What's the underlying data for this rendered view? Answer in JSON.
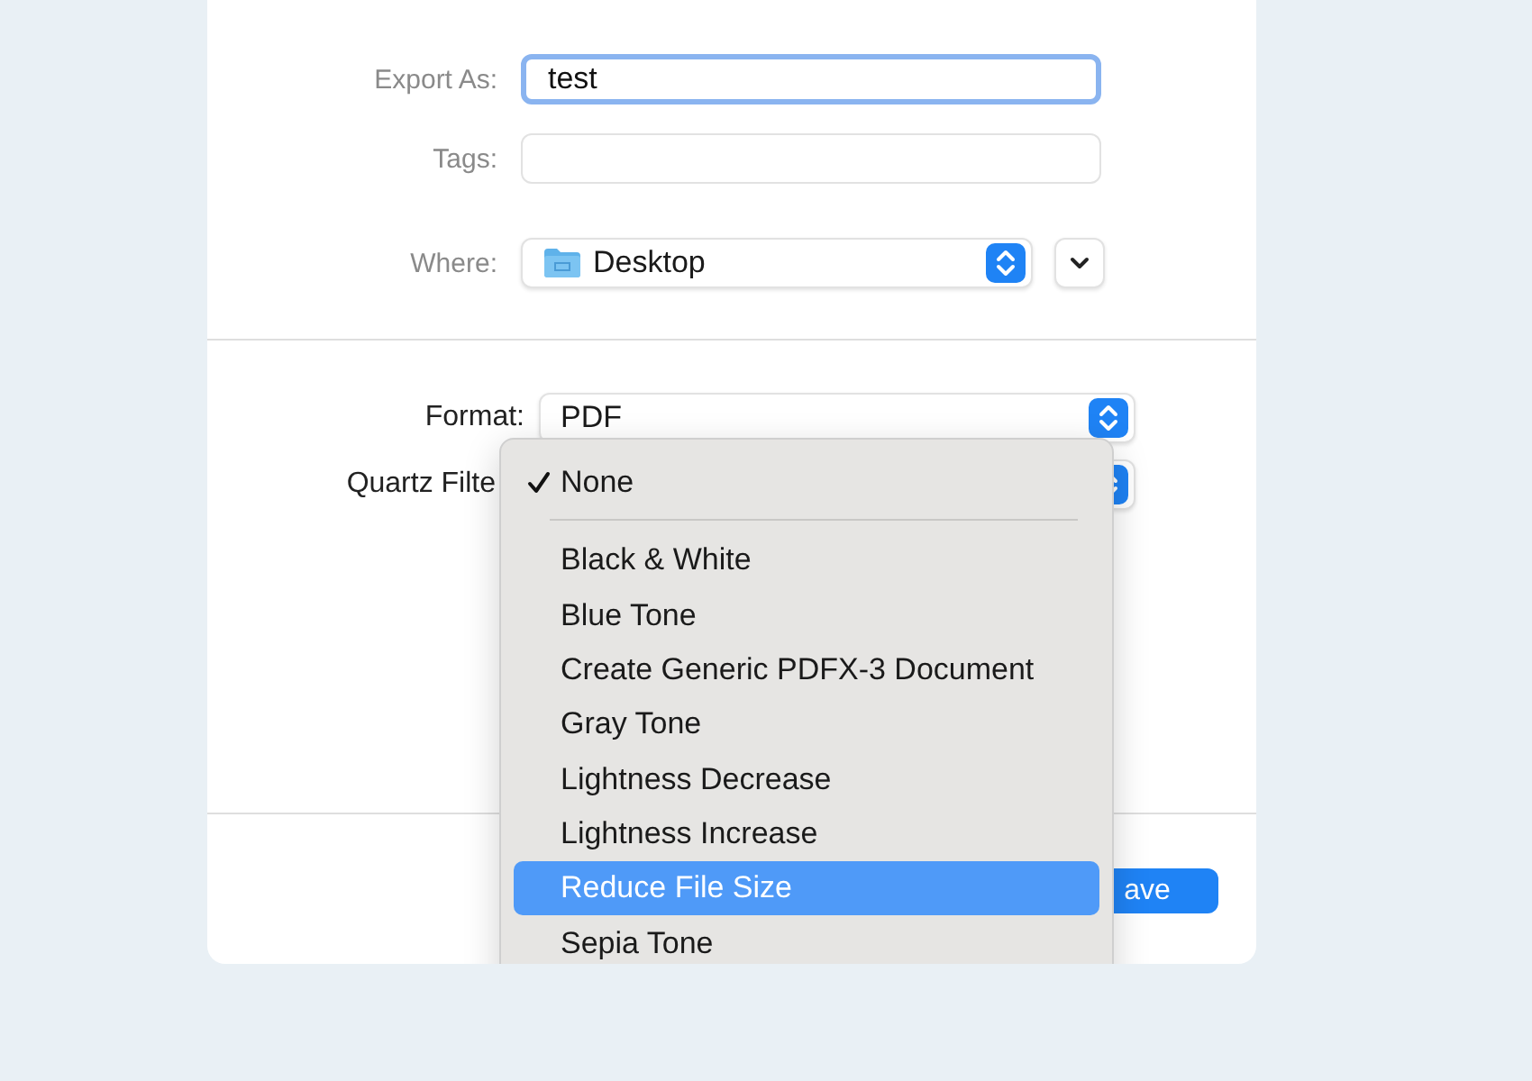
{
  "export_as": {
    "label": "Export As:",
    "value": "test",
    "focused": true
  },
  "tags": {
    "label": "Tags:"
  },
  "where": {
    "label": "Where:",
    "value": "Desktop"
  },
  "format": {
    "label": "Format:",
    "value": "PDF"
  },
  "quartz_filter": {
    "label": "Quartz Filte"
  },
  "filter_menu": {
    "items": [
      {
        "label": "None",
        "checked": true,
        "selected": false
      },
      {
        "label": "Black & White",
        "checked": false,
        "selected": false
      },
      {
        "label": "Blue Tone",
        "checked": false,
        "selected": false
      },
      {
        "label": "Create Generic PDFX-3 Document",
        "checked": false,
        "selected": false
      },
      {
        "label": "Gray Tone",
        "checked": false,
        "selected": false
      },
      {
        "label": "Lightness Decrease",
        "checked": false,
        "selected": false
      },
      {
        "label": "Lightness Increase",
        "checked": false,
        "selected": false
      },
      {
        "label": "Reduce File Size",
        "checked": false,
        "selected": true
      },
      {
        "label": "Sepia Tone",
        "checked": false,
        "selected": false
      }
    ]
  },
  "save_button": {
    "label": "ave"
  }
}
